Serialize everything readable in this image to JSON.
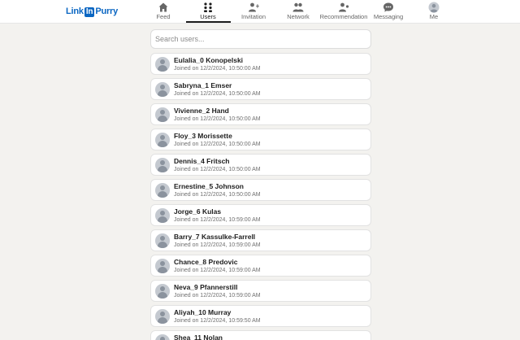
{
  "header": {
    "logo": {
      "prefix": "Link",
      "box": "In",
      "suffix": "Purry"
    },
    "nav": [
      {
        "label": "Feed",
        "icon": "home-icon"
      },
      {
        "label": "Users",
        "icon": "users-grid-icon",
        "active": true
      },
      {
        "label": "Invitation",
        "icon": "add-person-icon"
      },
      {
        "label": "Network",
        "icon": "network-icon"
      },
      {
        "label": "Recommendation",
        "icon": "recommend-person-icon"
      },
      {
        "label": "Messaging",
        "icon": "chat-bubble-icon"
      },
      {
        "label": "Me",
        "icon": "avatar-icon"
      }
    ]
  },
  "search": {
    "placeholder": "Search users..."
  },
  "users": [
    {
      "name": "Eulalia_0 Konopelski",
      "joined": "Joined on 12/2/2024, 10:50:00 AM"
    },
    {
      "name": "Sabryna_1 Emser",
      "joined": "Joined on 12/2/2024, 10:50:00 AM"
    },
    {
      "name": "Vivienne_2 Hand",
      "joined": "Joined on 12/2/2024, 10:50:00 AM"
    },
    {
      "name": "Floy_3 Morissette",
      "joined": "Joined on 12/2/2024, 10:50:00 AM"
    },
    {
      "name": "Dennis_4 Fritsch",
      "joined": "Joined on 12/2/2024, 10:50:00 AM"
    },
    {
      "name": "Ernestine_5 Johnson",
      "joined": "Joined on 12/2/2024, 10:50:00 AM"
    },
    {
      "name": "Jorge_6 Kulas",
      "joined": "Joined on 12/2/2024, 10:59:00 AM"
    },
    {
      "name": "Barry_7 Kassulke-Farrell",
      "joined": "Joined on 12/2/2024, 10:59:00 AM"
    },
    {
      "name": "Chance_8 Predovic",
      "joined": "Joined on 12/2/2024, 10:59:00 AM"
    },
    {
      "name": "Neva_9 Pfannerstill",
      "joined": "Joined on 12/2/2024, 10:59:00 AM"
    },
    {
      "name": "Aliyah_10 Murray",
      "joined": "Joined on 12/2/2024, 10:59:50 AM"
    },
    {
      "name": "Shea_11 Nolan",
      "joined": ""
    }
  ],
  "colors": {
    "brand": "#0a66c2",
    "background": "#f3f2ef",
    "card": "#ffffff"
  }
}
